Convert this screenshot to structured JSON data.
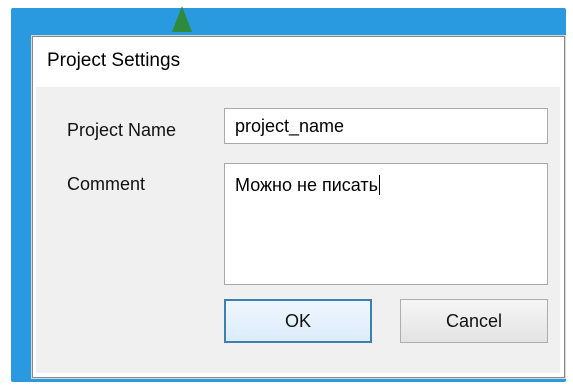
{
  "dialog": {
    "title": "Project Settings"
  },
  "fields": {
    "project_name": {
      "label": "Project Name",
      "value": "project_name"
    },
    "comment": {
      "label": "Comment",
      "value": "Можно не писать"
    }
  },
  "buttons": {
    "ok_label": "OK",
    "cancel_label": "Cancel"
  },
  "colors": {
    "desktop_background": "#2a9ae0",
    "dialog_client": "#f0f0f0",
    "default_button_border": "#3c7fb1"
  },
  "icons": {
    "background_mark": "tree-icon",
    "text_cursor": "caret-icon"
  }
}
